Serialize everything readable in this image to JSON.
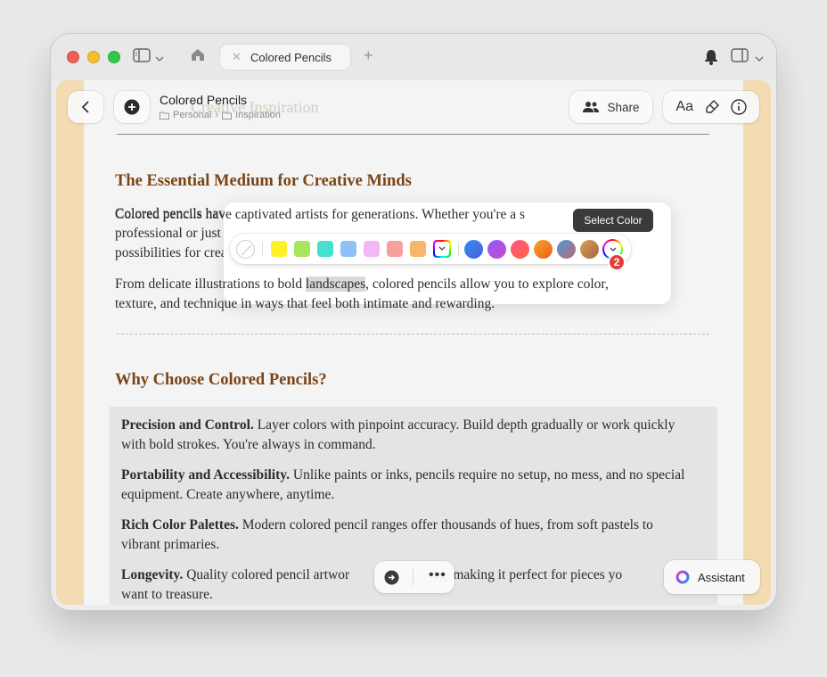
{
  "tab": {
    "title": "Colored Pencils"
  },
  "toolbar": {
    "doc_title": "Colored Pencils",
    "breadcrumb": [
      "Personal",
      "Inspiration"
    ],
    "share_label": "Share",
    "font_label": "Aa"
  },
  "article": {
    "faded_heading": "Creative Inspiration",
    "h1": "The Essential Medium for Creative Minds",
    "p1_line1_pre": "Colored pencils have captivated artists for generations. Whether you're a s",
    "p1_line2": "professional or just discovering your artistic voice, they offer versatility and endless",
    "p1_line3": "possibilities for creative expression.",
    "p2_pre": "From delicate illustrations to bold ",
    "p2_highlight": "landscapes",
    "p2_post": ", colored pencils allow you to explore color,",
    "p2_line2": "texture, and technique in ways that feel both intimate and rewarding.",
    "h2": "Why Choose Colored Pencils?",
    "items": [
      {
        "bold": "Precision and Control.",
        "text": " Layer colors with pinpoint accuracy. Build depth gradually or work quickly with bold strokes. You're always in command."
      },
      {
        "bold": "Portability and Accessibility.",
        "text": " Unlike paints or inks, pencils require no setup, no mess, and no special equipment. Create anywhere, anytime."
      },
      {
        "bold": "Rich Color Palettes.",
        "text": " Modern colored pencil ranges offer thousands of hues, from soft pastels to vibrant primaries."
      },
      {
        "bold": "Longevity.",
        "text": " Quality colored pencil artwor",
        "tail": "ng, making it perfect for pieces yo",
        "line2": "want to treasure."
      }
    ]
  },
  "palette": {
    "swatches": [
      "#fdf228",
      "#a8e55a",
      "#44e0d0",
      "#8fc1f7",
      "#f1b7f7",
      "#f7a0a0",
      "#f8b66b"
    ],
    "gradients": [
      "linear-gradient(135deg,#2f8df0,#4e5ee0)",
      "linear-gradient(135deg,#8e5cf2,#c54bd6)",
      "linear-gradient(135deg,#ff4f8a,#ff6a3d)",
      "linear-gradient(135deg,#f7a425,#ea5f1d)",
      "linear-gradient(135deg,#4b9bd6,#c0667a)",
      "linear-gradient(135deg,#d7a25a,#a8633c)"
    ]
  },
  "tooltip": "Select Color",
  "badge": "2",
  "assistant_label": "Assistant"
}
